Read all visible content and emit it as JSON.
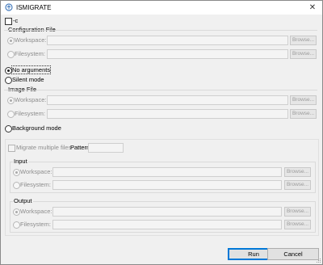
{
  "window": {
    "title": "ISMIGRATE",
    "close_glyph": "✕"
  },
  "top_checkbox": {
    "label": "-c",
    "checked": false
  },
  "config_file": {
    "title": "Configuration File",
    "workspace_label": "Workspace:",
    "filesystem_label": "Filesystem:",
    "workspace_browse": "Browse...",
    "filesystem_browse": "Browse..."
  },
  "modes": {
    "no_arguments": "No arguments",
    "silent_mode": "Silent mode",
    "background_mode": "Background mode",
    "selected": "no_arguments"
  },
  "image_file": {
    "title": "Image File",
    "workspace_label": "Workspace:",
    "filesystem_label": "Filesystem:",
    "workspace_browse": "Browse...",
    "filesystem_browse": "Browse..."
  },
  "migrate": {
    "checkbox_label": "Migrate multiple files",
    "pattern_label": "Pattern",
    "pattern_value": ""
  },
  "input_group": {
    "title": "Input",
    "workspace_label": "Workspace:",
    "filesystem_label": "Filesystem:",
    "workspace_browse": "Browse...",
    "filesystem_browse": "Browse..."
  },
  "output_group": {
    "title": "Output",
    "workspace_label": "Workspace:",
    "filesystem_label": "Filesystem:",
    "workspace_browse": "Browse...",
    "filesystem_browse": "Browse..."
  },
  "buttons": {
    "run": "Run",
    "cancel": "Cancel"
  },
  "colors": {
    "accent": "#0078d7",
    "disabled_text": "#8d8d8d",
    "background": "#f0f0f0"
  }
}
